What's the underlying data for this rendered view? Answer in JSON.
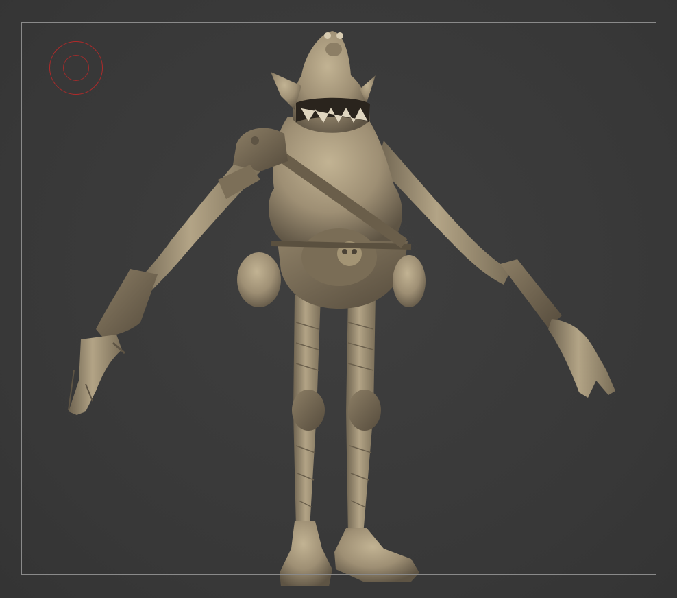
{
  "canvas": {
    "background_color": "#3a3a3a",
    "frame_color": "#8a8a8a",
    "brush_color": "#b02a2a",
    "clay_color": "#9c8d72"
  },
  "model": {
    "icon": "sculpted-goblin-model"
  },
  "brush": {
    "icon": "brush-cursor-icon"
  }
}
